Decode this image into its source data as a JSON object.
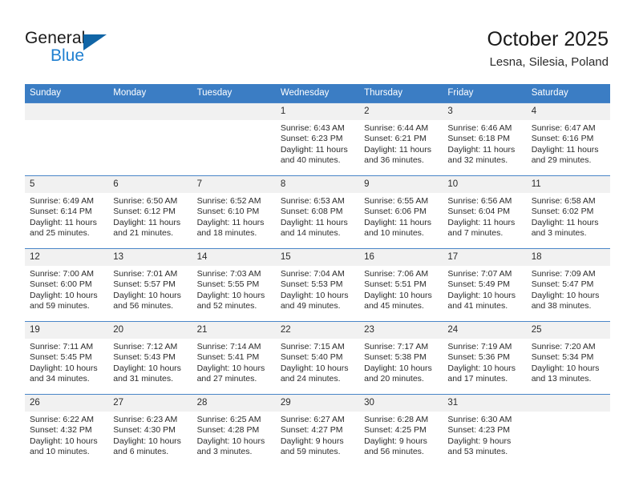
{
  "brand": {
    "name_dark": "General",
    "name_light": "Blue"
  },
  "header": {
    "title": "October 2025",
    "subtitle": "Lesna, Silesia, Poland"
  },
  "colors": {
    "header_bar": "#3b7dc4",
    "brand_blue": "#1f7fd0",
    "logo_triangle": "#1165a6",
    "daynum_background": "#f1f1f1",
    "grid_line": "#4a86c8"
  },
  "weekday_headers": [
    "Sunday",
    "Monday",
    "Tuesday",
    "Wednesday",
    "Thursday",
    "Friday",
    "Saturday"
  ],
  "weeks": [
    [
      {
        "day": "",
        "sunrise": "",
        "sunset": "",
        "daylight_1": "",
        "daylight_2": "",
        "blank": true
      },
      {
        "day": "",
        "sunrise": "",
        "sunset": "",
        "daylight_1": "",
        "daylight_2": "",
        "blank": true
      },
      {
        "day": "",
        "sunrise": "",
        "sunset": "",
        "daylight_1": "",
        "daylight_2": "",
        "blank": true
      },
      {
        "day": "1",
        "sunrise": "Sunrise: 6:43 AM",
        "sunset": "Sunset: 6:23 PM",
        "daylight_1": "Daylight: 11 hours",
        "daylight_2": "and 40 minutes."
      },
      {
        "day": "2",
        "sunrise": "Sunrise: 6:44 AM",
        "sunset": "Sunset: 6:21 PM",
        "daylight_1": "Daylight: 11 hours",
        "daylight_2": "and 36 minutes."
      },
      {
        "day": "3",
        "sunrise": "Sunrise: 6:46 AM",
        "sunset": "Sunset: 6:18 PM",
        "daylight_1": "Daylight: 11 hours",
        "daylight_2": "and 32 minutes."
      },
      {
        "day": "4",
        "sunrise": "Sunrise: 6:47 AM",
        "sunset": "Sunset: 6:16 PM",
        "daylight_1": "Daylight: 11 hours",
        "daylight_2": "and 29 minutes."
      }
    ],
    [
      {
        "day": "5",
        "sunrise": "Sunrise: 6:49 AM",
        "sunset": "Sunset: 6:14 PM",
        "daylight_1": "Daylight: 11 hours",
        "daylight_2": "and 25 minutes."
      },
      {
        "day": "6",
        "sunrise": "Sunrise: 6:50 AM",
        "sunset": "Sunset: 6:12 PM",
        "daylight_1": "Daylight: 11 hours",
        "daylight_2": "and 21 minutes."
      },
      {
        "day": "7",
        "sunrise": "Sunrise: 6:52 AM",
        "sunset": "Sunset: 6:10 PM",
        "daylight_1": "Daylight: 11 hours",
        "daylight_2": "and 18 minutes."
      },
      {
        "day": "8",
        "sunrise": "Sunrise: 6:53 AM",
        "sunset": "Sunset: 6:08 PM",
        "daylight_1": "Daylight: 11 hours",
        "daylight_2": "and 14 minutes."
      },
      {
        "day": "9",
        "sunrise": "Sunrise: 6:55 AM",
        "sunset": "Sunset: 6:06 PM",
        "daylight_1": "Daylight: 11 hours",
        "daylight_2": "and 10 minutes."
      },
      {
        "day": "10",
        "sunrise": "Sunrise: 6:56 AM",
        "sunset": "Sunset: 6:04 PM",
        "daylight_1": "Daylight: 11 hours",
        "daylight_2": "and 7 minutes."
      },
      {
        "day": "11",
        "sunrise": "Sunrise: 6:58 AM",
        "sunset": "Sunset: 6:02 PM",
        "daylight_1": "Daylight: 11 hours",
        "daylight_2": "and 3 minutes."
      }
    ],
    [
      {
        "day": "12",
        "sunrise": "Sunrise: 7:00 AM",
        "sunset": "Sunset: 6:00 PM",
        "daylight_1": "Daylight: 10 hours",
        "daylight_2": "and 59 minutes."
      },
      {
        "day": "13",
        "sunrise": "Sunrise: 7:01 AM",
        "sunset": "Sunset: 5:57 PM",
        "daylight_1": "Daylight: 10 hours",
        "daylight_2": "and 56 minutes."
      },
      {
        "day": "14",
        "sunrise": "Sunrise: 7:03 AM",
        "sunset": "Sunset: 5:55 PM",
        "daylight_1": "Daylight: 10 hours",
        "daylight_2": "and 52 minutes."
      },
      {
        "day": "15",
        "sunrise": "Sunrise: 7:04 AM",
        "sunset": "Sunset: 5:53 PM",
        "daylight_1": "Daylight: 10 hours",
        "daylight_2": "and 49 minutes."
      },
      {
        "day": "16",
        "sunrise": "Sunrise: 7:06 AM",
        "sunset": "Sunset: 5:51 PM",
        "daylight_1": "Daylight: 10 hours",
        "daylight_2": "and 45 minutes."
      },
      {
        "day": "17",
        "sunrise": "Sunrise: 7:07 AM",
        "sunset": "Sunset: 5:49 PM",
        "daylight_1": "Daylight: 10 hours",
        "daylight_2": "and 41 minutes."
      },
      {
        "day": "18",
        "sunrise": "Sunrise: 7:09 AM",
        "sunset": "Sunset: 5:47 PM",
        "daylight_1": "Daylight: 10 hours",
        "daylight_2": "and 38 minutes."
      }
    ],
    [
      {
        "day": "19",
        "sunrise": "Sunrise: 7:11 AM",
        "sunset": "Sunset: 5:45 PM",
        "daylight_1": "Daylight: 10 hours",
        "daylight_2": "and 34 minutes."
      },
      {
        "day": "20",
        "sunrise": "Sunrise: 7:12 AM",
        "sunset": "Sunset: 5:43 PM",
        "daylight_1": "Daylight: 10 hours",
        "daylight_2": "and 31 minutes."
      },
      {
        "day": "21",
        "sunrise": "Sunrise: 7:14 AM",
        "sunset": "Sunset: 5:41 PM",
        "daylight_1": "Daylight: 10 hours",
        "daylight_2": "and 27 minutes."
      },
      {
        "day": "22",
        "sunrise": "Sunrise: 7:15 AM",
        "sunset": "Sunset: 5:40 PM",
        "daylight_1": "Daylight: 10 hours",
        "daylight_2": "and 24 minutes."
      },
      {
        "day": "23",
        "sunrise": "Sunrise: 7:17 AM",
        "sunset": "Sunset: 5:38 PM",
        "daylight_1": "Daylight: 10 hours",
        "daylight_2": "and 20 minutes."
      },
      {
        "day": "24",
        "sunrise": "Sunrise: 7:19 AM",
        "sunset": "Sunset: 5:36 PM",
        "daylight_1": "Daylight: 10 hours",
        "daylight_2": "and 17 minutes."
      },
      {
        "day": "25",
        "sunrise": "Sunrise: 7:20 AM",
        "sunset": "Sunset: 5:34 PM",
        "daylight_1": "Daylight: 10 hours",
        "daylight_2": "and 13 minutes."
      }
    ],
    [
      {
        "day": "26",
        "sunrise": "Sunrise: 6:22 AM",
        "sunset": "Sunset: 4:32 PM",
        "daylight_1": "Daylight: 10 hours",
        "daylight_2": "and 10 minutes."
      },
      {
        "day": "27",
        "sunrise": "Sunrise: 6:23 AM",
        "sunset": "Sunset: 4:30 PM",
        "daylight_1": "Daylight: 10 hours",
        "daylight_2": "and 6 minutes."
      },
      {
        "day": "28",
        "sunrise": "Sunrise: 6:25 AM",
        "sunset": "Sunset: 4:28 PM",
        "daylight_1": "Daylight: 10 hours",
        "daylight_2": "and 3 minutes."
      },
      {
        "day": "29",
        "sunrise": "Sunrise: 6:27 AM",
        "sunset": "Sunset: 4:27 PM",
        "daylight_1": "Daylight: 9 hours",
        "daylight_2": "and 59 minutes."
      },
      {
        "day": "30",
        "sunrise": "Sunrise: 6:28 AM",
        "sunset": "Sunset: 4:25 PM",
        "daylight_1": "Daylight: 9 hours",
        "daylight_2": "and 56 minutes."
      },
      {
        "day": "31",
        "sunrise": "Sunrise: 6:30 AM",
        "sunset": "Sunset: 4:23 PM",
        "daylight_1": "Daylight: 9 hours",
        "daylight_2": "and 53 minutes."
      },
      {
        "day": "",
        "sunrise": "",
        "sunset": "",
        "daylight_1": "",
        "daylight_2": "",
        "blank": true
      }
    ]
  ]
}
